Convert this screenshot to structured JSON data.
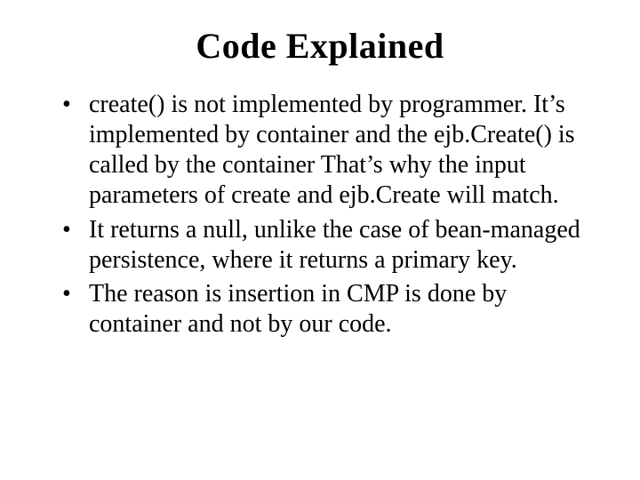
{
  "title": "Code Explained",
  "bullets": [
    "create() is not implemented by programmer. It’s implemented by container and the ejb.Create() is called by the container That’s why  the input parameters of create and ejb.Create will match.",
    "It returns  a null, unlike the case of bean-managed persistence, where it returns a primary key.",
    "The reason is insertion in CMP is done by container and not by our code."
  ]
}
